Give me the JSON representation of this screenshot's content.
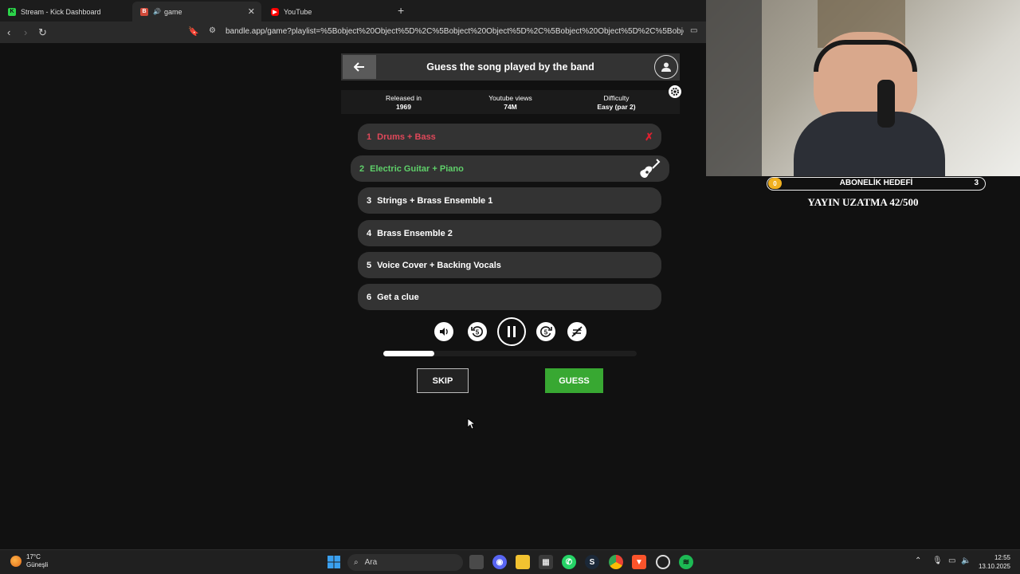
{
  "browser": {
    "tabs": [
      {
        "label": "Stream - Kick Dashboard",
        "active": false,
        "favicon": "kick-icon"
      },
      {
        "label": "game",
        "active": true,
        "favicon": "bandle-icon"
      },
      {
        "label": "YouTube",
        "active": false,
        "favicon": "youtube-icon"
      }
    ],
    "new_tab": "+",
    "url": "bandle.app/game?playlist=%5Bobject%20Object%5D%2C%5Bobject%20Object%5D%2C%5Bobject%20Object%5D%2C%5Bobject%20Obj..."
  },
  "game": {
    "title": "Guess the song played by the band",
    "info": [
      {
        "label": "Released in",
        "value": "1969"
      },
      {
        "label": "Youtube views",
        "value": "74M"
      },
      {
        "label": "Difficulty",
        "value": "Easy (par 2)"
      }
    ],
    "stems": [
      {
        "num": "1",
        "label": "Drums + Bass",
        "state": "failed"
      },
      {
        "num": "2",
        "label": "Electric Guitar + Piano",
        "state": "current"
      },
      {
        "num": "3",
        "label": "Strings + Brass Ensemble 1",
        "state": "locked"
      },
      {
        "num": "4",
        "label": "Brass Ensemble 2",
        "state": "locked"
      },
      {
        "num": "5",
        "label": "Voice Cover + Backing Vocals",
        "state": "locked"
      },
      {
        "num": "6",
        "label": "Get a clue",
        "state": "locked"
      }
    ],
    "rewind_label": "5",
    "forward_label": "5",
    "progress": 0.2,
    "skip_label": "SKIP",
    "guess_label": "GUESS",
    "colors": {
      "fail": "#e0485a",
      "current": "#5fd06a",
      "guess": "#38a832"
    }
  },
  "overlay": {
    "goal_current": "0",
    "goal_label": "ABONELİK HEDEFİ",
    "goal_max": "3",
    "stream_extension": "YAYIN UZATMA 42/500"
  },
  "taskbar": {
    "weather_temp": "17°C",
    "weather_desc": "Güneşli",
    "search_placeholder": "Ara",
    "time": "12:55",
    "date": "13.10.2025"
  }
}
